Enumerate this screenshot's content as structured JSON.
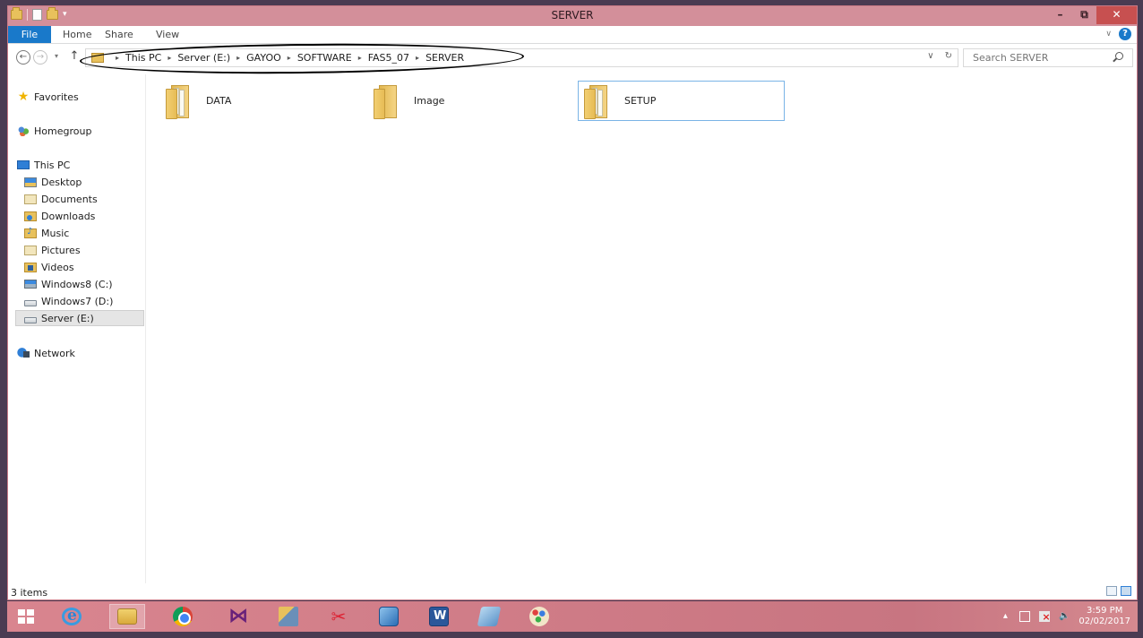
{
  "window": {
    "title": "SERVER",
    "controls": {
      "minimize": "–",
      "restore": "⧉",
      "close": "✕"
    }
  },
  "ribbon": {
    "tabs": [
      "File",
      "Home",
      "Share",
      "View"
    ],
    "active_tab": "File",
    "help_label": "?",
    "expand_label": "∨"
  },
  "nav": {
    "back_label": "←",
    "forward_label": "→",
    "recent_label": "▾",
    "up_label": "↑",
    "breadcrumb": [
      "This PC",
      "Server (E:)",
      "GAYOO",
      "SOFTWARE",
      "FAS5_07",
      "SERVER"
    ],
    "dropdown_label": "∨",
    "refresh_label": "↻",
    "search_placeholder": "Search SERVER"
  },
  "sidebar": {
    "favorites": "Favorites",
    "homegroup": "Homegroup",
    "this_pc": "This PC",
    "pc_items": [
      {
        "label": "Desktop",
        "icon": "desktop-icon"
      },
      {
        "label": "Documents",
        "icon": "documents-icon"
      },
      {
        "label": "Downloads",
        "icon": "downloads-icon"
      },
      {
        "label": "Music",
        "icon": "music-icon"
      },
      {
        "label": "Pictures",
        "icon": "pictures-icon"
      },
      {
        "label": "Videos",
        "icon": "videos-icon"
      },
      {
        "label": "Windows8 (C:)",
        "icon": "windows-drive-icon"
      },
      {
        "label": "Windows7 (D:)",
        "icon": "drive-icon"
      },
      {
        "label": "Server (E:)",
        "icon": "drive-icon"
      }
    ],
    "selected": "Server (E:)",
    "network": "Network"
  },
  "content": {
    "items": [
      {
        "name": "DATA",
        "type": "folder"
      },
      {
        "name": "Image",
        "type": "folder"
      },
      {
        "name": "SETUP",
        "type": "folder"
      }
    ],
    "selected": "SETUP"
  },
  "status": {
    "item_count": "3 items"
  },
  "taskbar": {
    "apps": [
      "internet-explorer",
      "file-explorer",
      "chrome",
      "visual-studio",
      "tool",
      "snipping-tool",
      "virtualbox",
      "word",
      "note",
      "paint"
    ],
    "active_app": "file-explorer",
    "tray": {
      "overflow": "▴",
      "volume": "🔈",
      "time": "3:59 PM",
      "date": "02/02/2017"
    }
  },
  "colors": {
    "accent": "#1979ca",
    "titlebar": "#d38f9a",
    "taskbar": "#c87581",
    "close_button": "#c75050"
  }
}
